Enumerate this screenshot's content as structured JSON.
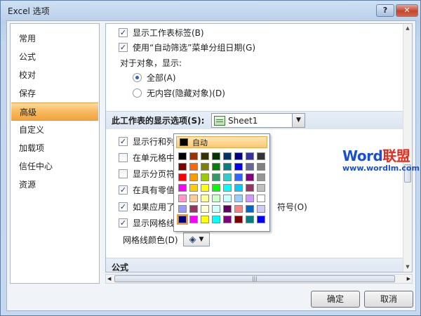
{
  "window": {
    "title": "Excel 选项",
    "help_label": "?",
    "close_label": "✕"
  },
  "sidebar": {
    "items": [
      {
        "label": "常用",
        "active": false
      },
      {
        "label": "公式",
        "active": false
      },
      {
        "label": "校对",
        "active": false
      },
      {
        "label": "保存",
        "active": false
      },
      {
        "label": "高级",
        "active": true
      },
      {
        "label": "自定义",
        "active": false
      },
      {
        "label": "加载项",
        "active": false
      },
      {
        "label": "信任中心",
        "active": false
      },
      {
        "label": "资源",
        "active": false
      }
    ]
  },
  "options": {
    "show_sheet_tabs": "显示工作表标签(B)",
    "group_dates": "使用“自动筛选”菜单分组日期(G)",
    "for_objects_label": "对于对象，显示:",
    "radio_all": "全部(A)",
    "radio_none": "无内容(隐藏对象)(D)",
    "sheet_section_label": "此工作表的显示选项(S):",
    "sheet_selected": "Sheet1",
    "show_row_col": "显示行和列标",
    "show_formulas": "在单元格中显",
    "show_page_breaks": "显示分页符(K",
    "show_zero": "在具有零值的",
    "show_outline": "如果应用了分",
    "show_outline_suffix": "符号(O)",
    "show_gridlines": "显示网格线(D",
    "gridline_color_label": "网格线颜色(D)",
    "formula_section": "公式"
  },
  "palette": {
    "auto_label": "自动",
    "colors": [
      "#000000",
      "#993300",
      "#333300",
      "#003300",
      "#003366",
      "#000080",
      "#333399",
      "#333333",
      "#800000",
      "#ff6600",
      "#808000",
      "#008000",
      "#008080",
      "#0000ff",
      "#666699",
      "#808080",
      "#ff0000",
      "#ff9900",
      "#99cc00",
      "#339966",
      "#33cccc",
      "#3366ff",
      "#800080",
      "#969696",
      "#ff00ff",
      "#ffcc00",
      "#ffff00",
      "#00ff00",
      "#00ffff",
      "#00ccff",
      "#993366",
      "#c0c0c0",
      "#ff99cc",
      "#ffcc99",
      "#ffff99",
      "#ccffcc",
      "#ccffff",
      "#99ccff",
      "#cc99ff",
      "#ffffff",
      "#9999ff",
      "#993366",
      "#ffffcc",
      "#ccffff",
      "#660066",
      "#ff8080",
      "#0066cc",
      "#ccccff",
      "#000080",
      "#ff00ff",
      "#ffff00",
      "#00ffff",
      "#800080",
      "#800000",
      "#008080",
      "#0000ff"
    ]
  },
  "watermark": {
    "brand_word": "Word",
    "brand_cn": "联盟",
    "url": "www.wordlm.com"
  },
  "buttons": {
    "ok": "确定",
    "cancel": "取消"
  }
}
